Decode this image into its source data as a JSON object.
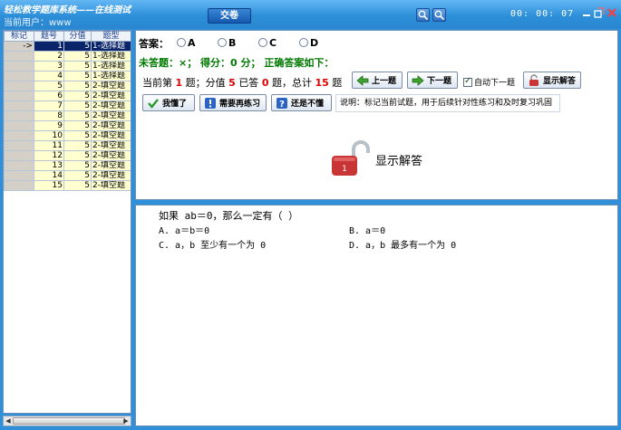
{
  "title_bar": {
    "app_title": "轻松教学题库系统——在线测试",
    "current_user_label": "当前用户：",
    "current_user_value": "www",
    "submit_label": "交卷",
    "timer": "00: 00: 07"
  },
  "grid": {
    "headers": [
      "标记",
      "题号",
      "分值",
      "题型"
    ],
    "rows": [
      {
        "mark": "->",
        "no": "1",
        "score": "5",
        "type": "1-选择题",
        "selected": true
      },
      {
        "mark": "",
        "no": "2",
        "score": "5",
        "type": "1-选择题"
      },
      {
        "mark": "",
        "no": "3",
        "score": "5",
        "type": "1-选择题"
      },
      {
        "mark": "",
        "no": "4",
        "score": "5",
        "type": "1-选择题"
      },
      {
        "mark": "",
        "no": "5",
        "score": "5",
        "type": "2-填空题"
      },
      {
        "mark": "",
        "no": "6",
        "score": "5",
        "type": "2-填空题"
      },
      {
        "mark": "",
        "no": "7",
        "score": "5",
        "type": "2-填空题"
      },
      {
        "mark": "",
        "no": "8",
        "score": "5",
        "type": "2-填空题"
      },
      {
        "mark": "",
        "no": "9",
        "score": "5",
        "type": "2-填空题"
      },
      {
        "mark": "",
        "no": "10",
        "score": "5",
        "type": "2-填空题"
      },
      {
        "mark": "",
        "no": "11",
        "score": "5",
        "type": "2-填空题"
      },
      {
        "mark": "",
        "no": "12",
        "score": "5",
        "type": "2-填空题"
      },
      {
        "mark": "",
        "no": "13",
        "score": "5",
        "type": "2-填空题"
      },
      {
        "mark": "",
        "no": "14",
        "score": "5",
        "type": "2-填空题"
      },
      {
        "mark": "",
        "no": "15",
        "score": "5",
        "type": "2-填空题"
      }
    ]
  },
  "answer": {
    "label": "答案：",
    "options": [
      "A",
      "B",
      "C",
      "D"
    ],
    "status_text": "未答题：×；  得分：0 分；   正确答案如下：",
    "info_prefix": "当前第",
    "current_no": "1",
    "info_mid1": "题；分值",
    "score": "5",
    "info_mid2": "已答",
    "answered": "0",
    "info_mid3": "题，总计",
    "total": "15",
    "info_suffix": "题",
    "prev_label": "上一题",
    "next_label": "下一题",
    "auto_next_label": "自动下一题",
    "show_answer_label": "显示解答",
    "understood_label": "我懂了",
    "need_practice_label": "需要再练习",
    "still_unclear_label": "还是不懂",
    "explain_text": "说明：标记当前试题，用于后续针对性练习和及时复习巩固",
    "lock_label": "显示解答",
    "lock_number": "1"
  },
  "question": {
    "stem": "如果 ab＝0，那么一定有（   ）",
    "options": [
      "A. a＝b＝0",
      "B. a＝0",
      "C. a，b 至少有一个为 0",
      "D. a，b 最多有一个为 0"
    ]
  },
  "colors": {
    "title_bar": "#2d8fd9",
    "accent_red": "#e00000",
    "status_green": "#007a00",
    "selection": "#0a246a"
  }
}
